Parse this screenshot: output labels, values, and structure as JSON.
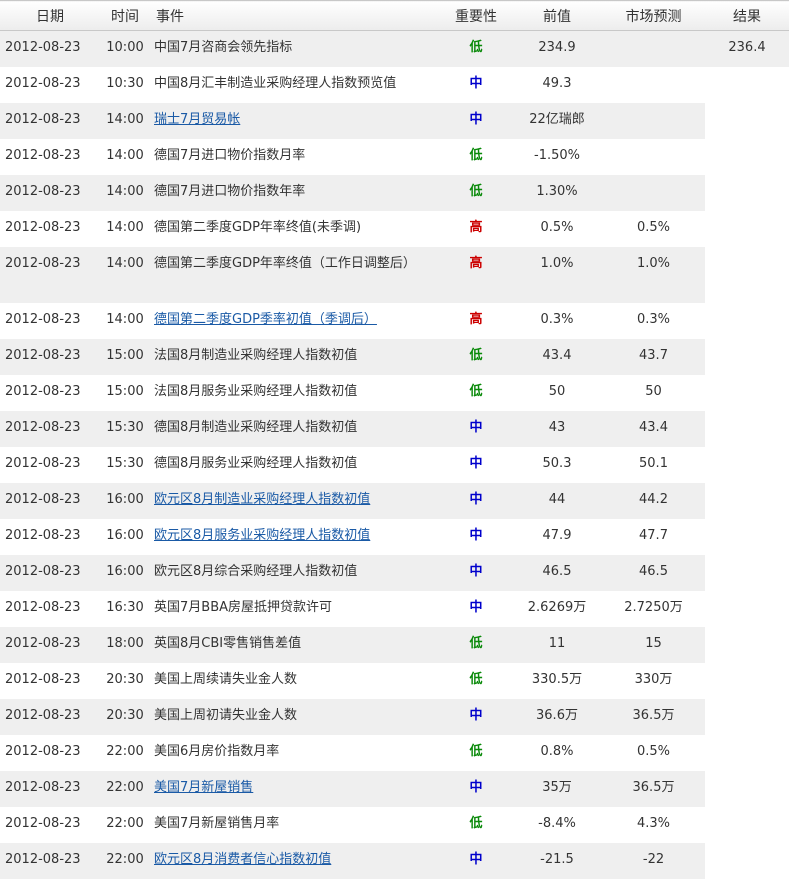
{
  "headers": {
    "date": "日期",
    "time": "时间",
    "event": "事件",
    "importance": "重要性",
    "previous": "前值",
    "forecast": "市场预测",
    "result": "结果"
  },
  "colors": {
    "low": "#0a8a0a",
    "medium": "#0000cc",
    "high": "#cc0000",
    "link": "#1a5aa6",
    "row_alt_bg": "#efefef"
  },
  "rows": [
    {
      "date": "2012-08-23",
      "time": "10:00",
      "event": "中国7月咨商会领先指标",
      "link": false,
      "importance": "低",
      "level": "low",
      "previous": "234.9",
      "forecast": "",
      "result": "236.4"
    },
    {
      "date": "2012-08-23",
      "time": "10:30",
      "event": "中国8月汇丰制造业采购经理人指数预览值",
      "link": false,
      "importance": "中",
      "level": "mid",
      "previous": "49.3",
      "forecast": "",
      "result": ""
    },
    {
      "date": "2012-08-23",
      "time": "14:00",
      "event": "瑞士7月贸易帐",
      "link": true,
      "importance": "中",
      "level": "mid",
      "previous": "22亿瑞郎",
      "forecast": "",
      "result": ""
    },
    {
      "date": "2012-08-23",
      "time": "14:00",
      "event": "德国7月进口物价指数月率",
      "link": false,
      "importance": "低",
      "level": "low",
      "previous": "-1.50%",
      "forecast": "",
      "result": ""
    },
    {
      "date": "2012-08-23",
      "time": "14:00",
      "event": "德国7月进口物价指数年率",
      "link": false,
      "importance": "低",
      "level": "low",
      "previous": "1.30%",
      "forecast": "",
      "result": ""
    },
    {
      "date": "2012-08-23",
      "time": "14:00",
      "event": "德国第二季度GDP年率终值(未季调)",
      "link": false,
      "importance": "高",
      "level": "high",
      "previous": "0.5%",
      "forecast": "0.5%",
      "result": ""
    },
    {
      "date": "2012-08-23",
      "time": "14:00",
      "event": "德国第二季度GDP年率终值（工作日调整后）",
      "link": false,
      "importance": "高",
      "level": "high",
      "previous": "1.0%",
      "forecast": "1.0%",
      "result": ""
    },
    {
      "date": "2012-08-23",
      "time": "14:00",
      "event": "德国第二季度GDP季率初值（季调后）",
      "link": true,
      "importance": "高",
      "level": "high",
      "previous": "0.3%",
      "forecast": "0.3%",
      "result": ""
    },
    {
      "date": "2012-08-23",
      "time": "15:00",
      "event": "法国8月制造业采购经理人指数初值",
      "link": false,
      "importance": "低",
      "level": "low",
      "previous": "43.4",
      "forecast": "43.7",
      "result": ""
    },
    {
      "date": "2012-08-23",
      "time": "15:00",
      "event": "法国8月服务业采购经理人指数初值",
      "link": false,
      "importance": "低",
      "level": "low",
      "previous": "50",
      "forecast": "50",
      "result": ""
    },
    {
      "date": "2012-08-23",
      "time": "15:30",
      "event": "德国8月制造业采购经理人指数初值",
      "link": false,
      "importance": "中",
      "level": "mid",
      "previous": "43",
      "forecast": "43.4",
      "result": ""
    },
    {
      "date": "2012-08-23",
      "time": "15:30",
      "event": "德国8月服务业采购经理人指数初值",
      "link": false,
      "importance": "中",
      "level": "mid",
      "previous": "50.3",
      "forecast": "50.1",
      "result": ""
    },
    {
      "date": "2012-08-23",
      "time": "16:00",
      "event": "欧元区8月制造业采购经理人指数初值",
      "link": true,
      "importance": "中",
      "level": "mid",
      "previous": "44",
      "forecast": "44.2",
      "result": ""
    },
    {
      "date": "2012-08-23",
      "time": "16:00",
      "event": "欧元区8月服务业采购经理人指数初值",
      "link": true,
      "importance": "中",
      "level": "mid",
      "previous": "47.9",
      "forecast": "47.7",
      "result": ""
    },
    {
      "date": "2012-08-23",
      "time": "16:00",
      "event": "欧元区8月综合采购经理人指数初值",
      "link": false,
      "importance": "中",
      "level": "mid",
      "previous": "46.5",
      "forecast": "46.5",
      "result": ""
    },
    {
      "date": "2012-08-23",
      "time": "16:30",
      "event": "英国7月BBA房屋抵押贷款许可",
      "link": false,
      "importance": "中",
      "level": "mid",
      "previous": "2.6269万",
      "forecast": "2.7250万",
      "result": ""
    },
    {
      "date": "2012-08-23",
      "time": "18:00",
      "event": "英国8月CBI零售销售差值",
      "link": false,
      "importance": "低",
      "level": "low",
      "previous": "11",
      "forecast": "15",
      "result": ""
    },
    {
      "date": "2012-08-23",
      "time": "20:30",
      "event": "美国上周续请失业金人数",
      "link": false,
      "importance": "低",
      "level": "low",
      "previous": "330.5万",
      "forecast": "330万",
      "result": ""
    },
    {
      "date": "2012-08-23",
      "time": "20:30",
      "event": "美国上周初请失业金人数",
      "link": false,
      "importance": "中",
      "level": "mid",
      "previous": "36.6万",
      "forecast": "36.5万",
      "result": ""
    },
    {
      "date": "2012-08-23",
      "time": "22:00",
      "event": "美国6月房价指数月率",
      "link": false,
      "importance": "低",
      "level": "low",
      "previous": "0.8%",
      "forecast": "0.5%",
      "result": ""
    },
    {
      "date": "2012-08-23",
      "time": "22:00",
      "event": "美国7月新屋销售",
      "link": true,
      "importance": "中",
      "level": "mid",
      "previous": "35万",
      "forecast": "36.5万",
      "result": ""
    },
    {
      "date": "2012-08-23",
      "time": "22:00",
      "event": "美国7月新屋销售月率",
      "link": false,
      "importance": "低",
      "level": "low",
      "previous": "-8.4%",
      "forecast": "4.3%",
      "result": ""
    },
    {
      "date": "2012-08-23",
      "time": "22:00",
      "event": "欧元区8月消费者信心指数初值",
      "link": true,
      "importance": "中",
      "level": "mid",
      "previous": "-21.5",
      "forecast": "-22",
      "result": ""
    }
  ]
}
